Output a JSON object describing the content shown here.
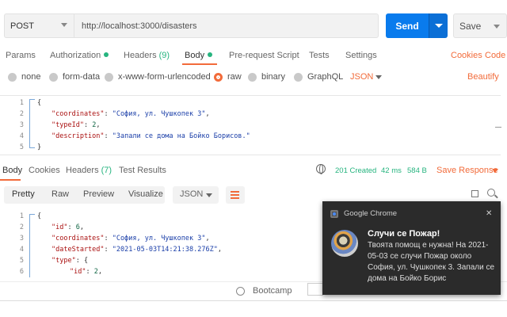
{
  "request": {
    "method": "POST",
    "url": "http://localhost:3000/disasters",
    "send_label": "Send",
    "save_label": "Save"
  },
  "request_tabs": {
    "params": "Params",
    "authorization": "Authorization",
    "headers": "Headers",
    "headers_count": "(9)",
    "body": "Body",
    "pre_request": "Pre-request Script",
    "tests": "Tests",
    "settings": "Settings",
    "cookies": "Cookies",
    "code": "Code"
  },
  "body_types": {
    "none": "none",
    "form_data": "form-data",
    "urlencoded": "x-www-form-urlencoded",
    "raw": "raw",
    "binary": "binary",
    "graphql": "GraphQL",
    "format": "JSON",
    "beautify": "Beautify"
  },
  "request_body": {
    "line_numbers": [
      "1",
      "2",
      "3",
      "4",
      "5"
    ],
    "l1": "{",
    "l2_key": "\"coordinates\"",
    "l2_val": "\"София, ул. Чушкопек 3\"",
    "l3_key": "\"typeId\"",
    "l3_val": "2",
    "l4_key": "\"description\"",
    "l4_val": "\"Запали се дома на Бойко Борисов.\"",
    "l5": "}"
  },
  "response_tabs": {
    "body": "Body",
    "cookies": "Cookies",
    "headers": "Headers",
    "headers_count": "(7)",
    "test_results": "Test Results",
    "status": "201 Created",
    "time": "42 ms",
    "size": "584 B",
    "save_response": "Save Response"
  },
  "response_view": {
    "pretty": "Pretty",
    "raw": "Raw",
    "preview": "Preview",
    "visualize": "Visualize",
    "format": "JSON"
  },
  "response_body": {
    "line_numbers": [
      "1",
      "2",
      "3",
      "4",
      "5",
      "6"
    ],
    "l1": "{",
    "l2_key": "\"id\"",
    "l2_val": "6",
    "l3_key": "\"coordinates\"",
    "l3_val": "\"София, ул. Чушкопек 3\"",
    "l4_key": "\"dateStarted\"",
    "l4_val": "\"2021-05-03T14:21:38.276Z\"",
    "l5_key": "\"type\"",
    "l5_val": "{",
    "l6_key": "\"id\"",
    "l6_val": "2"
  },
  "footer": {
    "bootcamp": "Bootcamp"
  },
  "notification": {
    "app": "Google Chrome",
    "close": "✕",
    "title": "Случи се Пожар!",
    "body": "Твоята помощ е нужна! На 2021-05-03 се случи Пожар около София, ул. Чушкопек 3. Запали се дома на Бойко Борис"
  },
  "colors": {
    "accent": "#f26b3a",
    "send": "#097bed",
    "status_green": "#26b47f",
    "notification_bg": "#2b2b2b"
  }
}
